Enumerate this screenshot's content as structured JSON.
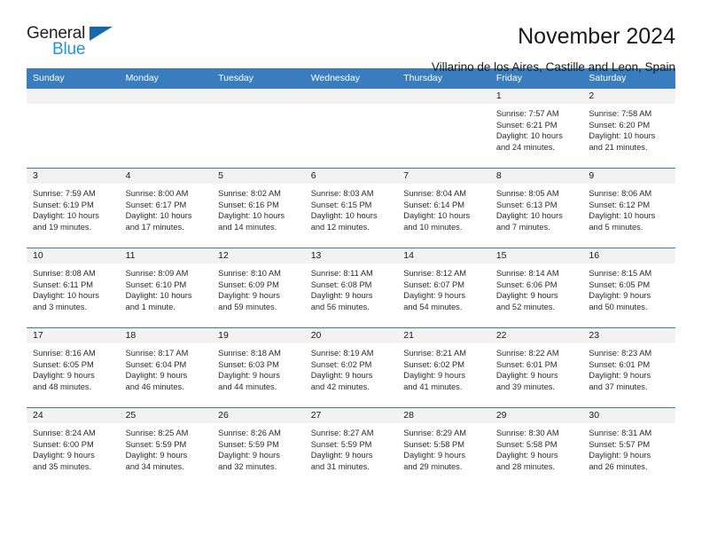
{
  "brand": {
    "name_part1": "General",
    "name_part2": "Blue",
    "triangle_color": "#1568b0",
    "blue_text_color": "#2a90d8"
  },
  "header": {
    "month_title": "November 2024",
    "location": "Villarino de los Aires, Castille and Leon, Spain"
  },
  "theme": {
    "header_row_bg": "#3a7dbf",
    "daynum_strip_bg": "#f2f2f2",
    "cell_border": "#3a7dbf",
    "text_color": "#1a1a1a"
  },
  "weekday_headers": [
    "Sunday",
    "Monday",
    "Tuesday",
    "Wednesday",
    "Thursday",
    "Friday",
    "Saturday"
  ],
  "weeks": [
    [
      {
        "day": "",
        "empty": true
      },
      {
        "day": "",
        "empty": true
      },
      {
        "day": "",
        "empty": true
      },
      {
        "day": "",
        "empty": true
      },
      {
        "day": "",
        "empty": true
      },
      {
        "day": "1",
        "sunrise": "Sunrise: 7:57 AM",
        "sunset": "Sunset: 6:21 PM",
        "daylight1": "Daylight: 10 hours",
        "daylight2": "and 24 minutes."
      },
      {
        "day": "2",
        "sunrise": "Sunrise: 7:58 AM",
        "sunset": "Sunset: 6:20 PM",
        "daylight1": "Daylight: 10 hours",
        "daylight2": "and 21 minutes."
      }
    ],
    [
      {
        "day": "3",
        "sunrise": "Sunrise: 7:59 AM",
        "sunset": "Sunset: 6:19 PM",
        "daylight1": "Daylight: 10 hours",
        "daylight2": "and 19 minutes."
      },
      {
        "day": "4",
        "sunrise": "Sunrise: 8:00 AM",
        "sunset": "Sunset: 6:17 PM",
        "daylight1": "Daylight: 10 hours",
        "daylight2": "and 17 minutes."
      },
      {
        "day": "5",
        "sunrise": "Sunrise: 8:02 AM",
        "sunset": "Sunset: 6:16 PM",
        "daylight1": "Daylight: 10 hours",
        "daylight2": "and 14 minutes."
      },
      {
        "day": "6",
        "sunrise": "Sunrise: 8:03 AM",
        "sunset": "Sunset: 6:15 PM",
        "daylight1": "Daylight: 10 hours",
        "daylight2": "and 12 minutes."
      },
      {
        "day": "7",
        "sunrise": "Sunrise: 8:04 AM",
        "sunset": "Sunset: 6:14 PM",
        "daylight1": "Daylight: 10 hours",
        "daylight2": "and 10 minutes."
      },
      {
        "day": "8",
        "sunrise": "Sunrise: 8:05 AM",
        "sunset": "Sunset: 6:13 PM",
        "daylight1": "Daylight: 10 hours",
        "daylight2": "and 7 minutes."
      },
      {
        "day": "9",
        "sunrise": "Sunrise: 8:06 AM",
        "sunset": "Sunset: 6:12 PM",
        "daylight1": "Daylight: 10 hours",
        "daylight2": "and 5 minutes."
      }
    ],
    [
      {
        "day": "10",
        "sunrise": "Sunrise: 8:08 AM",
        "sunset": "Sunset: 6:11 PM",
        "daylight1": "Daylight: 10 hours",
        "daylight2": "and 3 minutes."
      },
      {
        "day": "11",
        "sunrise": "Sunrise: 8:09 AM",
        "sunset": "Sunset: 6:10 PM",
        "daylight1": "Daylight: 10 hours",
        "daylight2": "and 1 minute."
      },
      {
        "day": "12",
        "sunrise": "Sunrise: 8:10 AM",
        "sunset": "Sunset: 6:09 PM",
        "daylight1": "Daylight: 9 hours",
        "daylight2": "and 59 minutes."
      },
      {
        "day": "13",
        "sunrise": "Sunrise: 8:11 AM",
        "sunset": "Sunset: 6:08 PM",
        "daylight1": "Daylight: 9 hours",
        "daylight2": "and 56 minutes."
      },
      {
        "day": "14",
        "sunrise": "Sunrise: 8:12 AM",
        "sunset": "Sunset: 6:07 PM",
        "daylight1": "Daylight: 9 hours",
        "daylight2": "and 54 minutes."
      },
      {
        "day": "15",
        "sunrise": "Sunrise: 8:14 AM",
        "sunset": "Sunset: 6:06 PM",
        "daylight1": "Daylight: 9 hours",
        "daylight2": "and 52 minutes."
      },
      {
        "day": "16",
        "sunrise": "Sunrise: 8:15 AM",
        "sunset": "Sunset: 6:05 PM",
        "daylight1": "Daylight: 9 hours",
        "daylight2": "and 50 minutes."
      }
    ],
    [
      {
        "day": "17",
        "sunrise": "Sunrise: 8:16 AM",
        "sunset": "Sunset: 6:05 PM",
        "daylight1": "Daylight: 9 hours",
        "daylight2": "and 48 minutes."
      },
      {
        "day": "18",
        "sunrise": "Sunrise: 8:17 AM",
        "sunset": "Sunset: 6:04 PM",
        "daylight1": "Daylight: 9 hours",
        "daylight2": "and 46 minutes."
      },
      {
        "day": "19",
        "sunrise": "Sunrise: 8:18 AM",
        "sunset": "Sunset: 6:03 PM",
        "daylight1": "Daylight: 9 hours",
        "daylight2": "and 44 minutes."
      },
      {
        "day": "20",
        "sunrise": "Sunrise: 8:19 AM",
        "sunset": "Sunset: 6:02 PM",
        "daylight1": "Daylight: 9 hours",
        "daylight2": "and 42 minutes."
      },
      {
        "day": "21",
        "sunrise": "Sunrise: 8:21 AM",
        "sunset": "Sunset: 6:02 PM",
        "daylight1": "Daylight: 9 hours",
        "daylight2": "and 41 minutes."
      },
      {
        "day": "22",
        "sunrise": "Sunrise: 8:22 AM",
        "sunset": "Sunset: 6:01 PM",
        "daylight1": "Daylight: 9 hours",
        "daylight2": "and 39 minutes."
      },
      {
        "day": "23",
        "sunrise": "Sunrise: 8:23 AM",
        "sunset": "Sunset: 6:01 PM",
        "daylight1": "Daylight: 9 hours",
        "daylight2": "and 37 minutes."
      }
    ],
    [
      {
        "day": "24",
        "sunrise": "Sunrise: 8:24 AM",
        "sunset": "Sunset: 6:00 PM",
        "daylight1": "Daylight: 9 hours",
        "daylight2": "and 35 minutes."
      },
      {
        "day": "25",
        "sunrise": "Sunrise: 8:25 AM",
        "sunset": "Sunset: 5:59 PM",
        "daylight1": "Daylight: 9 hours",
        "daylight2": "and 34 minutes."
      },
      {
        "day": "26",
        "sunrise": "Sunrise: 8:26 AM",
        "sunset": "Sunset: 5:59 PM",
        "daylight1": "Daylight: 9 hours",
        "daylight2": "and 32 minutes."
      },
      {
        "day": "27",
        "sunrise": "Sunrise: 8:27 AM",
        "sunset": "Sunset: 5:59 PM",
        "daylight1": "Daylight: 9 hours",
        "daylight2": "and 31 minutes."
      },
      {
        "day": "28",
        "sunrise": "Sunrise: 8:29 AM",
        "sunset": "Sunset: 5:58 PM",
        "daylight1": "Daylight: 9 hours",
        "daylight2": "and 29 minutes."
      },
      {
        "day": "29",
        "sunrise": "Sunrise: 8:30 AM",
        "sunset": "Sunset: 5:58 PM",
        "daylight1": "Daylight: 9 hours",
        "daylight2": "and 28 minutes."
      },
      {
        "day": "30",
        "sunrise": "Sunrise: 8:31 AM",
        "sunset": "Sunset: 5:57 PM",
        "daylight1": "Daylight: 9 hours",
        "daylight2": "and 26 minutes."
      }
    ]
  ]
}
